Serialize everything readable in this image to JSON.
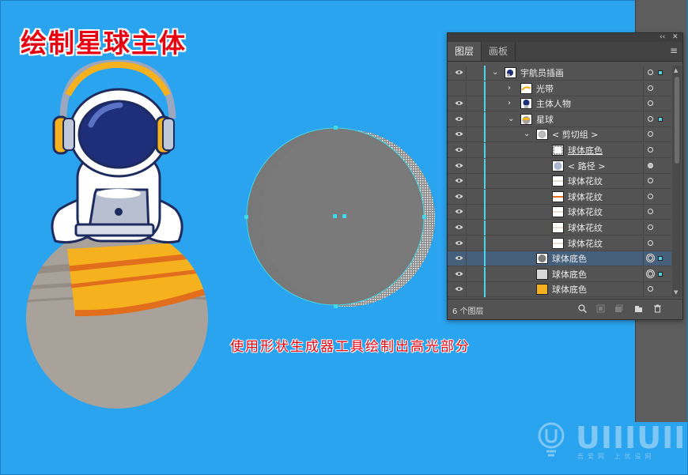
{
  "canvas": {
    "title": "绘制星球主体",
    "caption": "使用形状生成器工具绘制出高光部分",
    "background_color": "#2aa4ee",
    "title_color": "#e60012"
  },
  "layers_panel": {
    "tabs": [
      {
        "label": "图层",
        "active": true
      },
      {
        "label": "画板",
        "active": false
      }
    ],
    "panel_menu_icon": "hamburger-menu-icon",
    "collapse_icon": "double-chevron-icon",
    "close_icon": "close-icon",
    "rows": [
      {
        "name": "宇航员插画",
        "visible": true,
        "twist": "v",
        "thumb": "astronaut",
        "selected": false,
        "target": "circle",
        "sel_square": true
      },
      {
        "name": "光带",
        "visible": false,
        "twist": ">",
        "thumb": "band",
        "selected": false,
        "target": "circle",
        "sel_square": false
      },
      {
        "name": "主体人物",
        "visible": true,
        "twist": ">",
        "thumb": "figure",
        "selected": false,
        "target": "circle",
        "sel_square": false
      },
      {
        "name": "星球",
        "visible": true,
        "twist": "v",
        "thumb": "planet",
        "selected": false,
        "target": "circle",
        "sel_square": true
      },
      {
        "name": "< 剪切组 >",
        "visible": true,
        "twist": "v",
        "thumb": "clip",
        "selected": false,
        "target": "circle",
        "sel_square": false
      },
      {
        "name": "球体底色",
        "visible": true,
        "twist": "",
        "thumb": "clip-path",
        "selected": false,
        "target": "circle",
        "sel_square": false,
        "underline": true
      },
      {
        "name": "< 路径 >",
        "visible": true,
        "twist": "",
        "thumb": "path",
        "selected": false,
        "target": "filled",
        "sel_square": false
      },
      {
        "name": "球体花纹",
        "visible": true,
        "twist": "",
        "thumb": "stripe-white",
        "selected": false,
        "target": "circle",
        "sel_square": false
      },
      {
        "name": "球体花纹",
        "visible": true,
        "twist": "",
        "thumb": "stripe-orange",
        "selected": false,
        "target": "circle",
        "sel_square": false
      },
      {
        "name": "球体花纹",
        "visible": true,
        "twist": "",
        "thumb": "stripe-white",
        "selected": false,
        "target": "circle",
        "sel_square": false
      },
      {
        "name": "球体花纹",
        "visible": true,
        "twist": "",
        "thumb": "stripe-white",
        "selected": false,
        "target": "circle",
        "sel_square": false
      },
      {
        "name": "球体花纹",
        "visible": true,
        "twist": "",
        "thumb": "stripe-white",
        "selected": false,
        "target": "circle",
        "sel_square": false
      },
      {
        "name": "球体底色",
        "visible": true,
        "twist": "",
        "thumb": "gray-circle",
        "selected": true,
        "target": "double",
        "sel_square": true
      },
      {
        "name": "球体底色",
        "visible": true,
        "twist": "",
        "thumb": "light-gray",
        "selected": false,
        "target": "double",
        "sel_square": true
      },
      {
        "name": "球体底色",
        "visible": true,
        "twist": "",
        "thumb": "yellow",
        "selected": false,
        "target": "circle",
        "sel_square": false
      }
    ],
    "footer": {
      "layer_count": "6 个图层",
      "icons": [
        "locate-object-icon",
        "clipping-mask-icon",
        "new-sublayer-icon",
        "new-layer-icon",
        "delete-icon"
      ]
    },
    "accent_color": "#4fd3e8"
  },
  "watermark": {
    "logo_text": "UIIIUIII",
    "sub_text": "吾爱网 上优设网"
  }
}
